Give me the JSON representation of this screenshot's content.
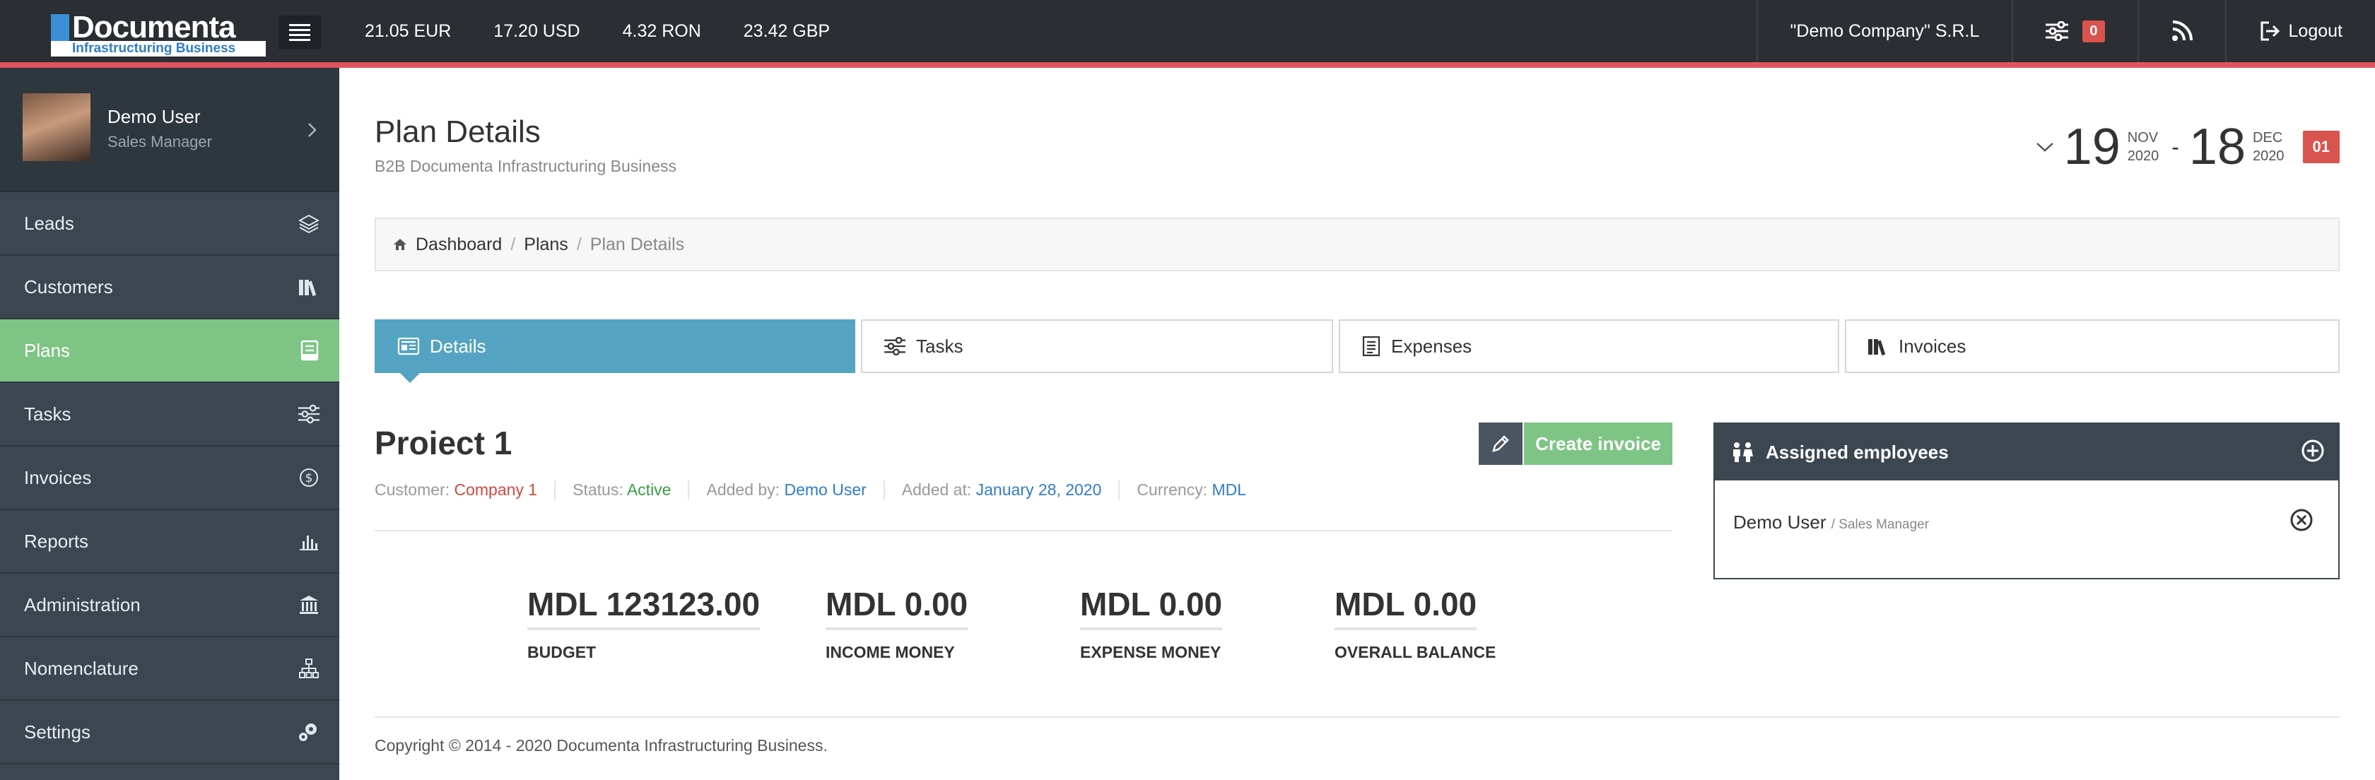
{
  "header": {
    "logo_name": "Documenta",
    "logo_tagline": "Infrastructuring Business",
    "rates": [
      "21.05 EUR",
      "17.20 USD",
      "4.32 RON",
      "23.42 GBP"
    ],
    "company": "\"Demo Company\" S.R.L",
    "notifications_count": "0",
    "logout_label": "Logout"
  },
  "sidebar": {
    "user": {
      "name": "Demo User",
      "role": "Sales Manager"
    },
    "items": [
      {
        "label": "Leads",
        "icon": "layers-icon"
      },
      {
        "label": "Customers",
        "icon": "books-icon"
      },
      {
        "label": "Plans",
        "icon": "plan-icon"
      },
      {
        "label": "Tasks",
        "icon": "sliders-icon"
      },
      {
        "label": "Invoices",
        "icon": "dollar-circle-icon"
      },
      {
        "label": "Reports",
        "icon": "bar-chart-icon"
      },
      {
        "label": "Administration",
        "icon": "bank-icon"
      },
      {
        "label": "Nomenclature",
        "icon": "sitemap-icon"
      },
      {
        "label": "Settings",
        "icon": "gears-icon"
      }
    ],
    "active_index": 2
  },
  "page": {
    "title": "Plan Details",
    "subtitle": "B2B Documenta Infrastructuring Business",
    "date_start": {
      "day": "19",
      "month": "NOV",
      "year": "2020"
    },
    "date_sep": "-",
    "date_end": {
      "day": "18",
      "month": "DEC",
      "year": "2020"
    },
    "date_badge": "01"
  },
  "breadcrumb": [
    "Dashboard",
    "Plans",
    "Plan Details"
  ],
  "tabs": [
    "Details",
    "Tasks",
    "Expenses",
    "Invoices"
  ],
  "project": {
    "title": "Proiect 1",
    "create_invoice_label": "Create invoice",
    "meta": {
      "customer_label": "Customer:",
      "customer": "Company 1",
      "status_label": "Status:",
      "status": "Active",
      "added_by_label": "Added by:",
      "added_by": "Demo User",
      "added_at_label": "Added at:",
      "added_at": "January 28, 2020",
      "currency_label": "Currency:",
      "currency": "MDL"
    },
    "stats": [
      {
        "value": "MDL 123123.00",
        "label": "BUDGET"
      },
      {
        "value": "MDL 0.00",
        "label": "INCOME MONEY"
      },
      {
        "value": "MDL 0.00",
        "label": "EXPENSE MONEY"
      },
      {
        "value": "MDL 0.00",
        "label": "OVERALL BALANCE"
      }
    ]
  },
  "assigned": {
    "title": "Assigned employees",
    "employees": [
      {
        "name": "Demo User",
        "role": "/ Sales Manager"
      }
    ]
  },
  "footer": {
    "copyright": "Copyright © 2014 - 2020 Documenta Infrastructuring Business."
  },
  "colors": {
    "accent_green": "#7ec485",
    "tab_active": "#55a3c2",
    "topbar": "#2b2e33",
    "sidebar": "#3b4650",
    "badge_red": "#d9534f"
  }
}
